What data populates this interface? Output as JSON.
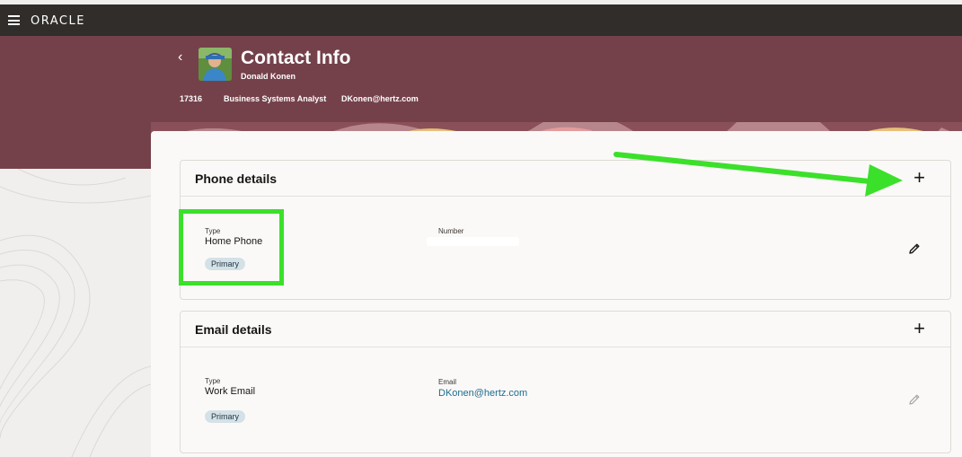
{
  "topbar": {
    "logo": "ORACLE"
  },
  "header": {
    "title": "Contact Info",
    "name": "Donald Konen",
    "person_number": "17316",
    "job_title": "Business Systems Analyst",
    "email": "DKonen@hertz.com"
  },
  "phone_section": {
    "title": "Phone details",
    "type_label": "Type",
    "type_value": "Home Phone",
    "badge": "Primary",
    "number_label": "Number",
    "number_value": ""
  },
  "email_section": {
    "title": "Email details",
    "type_label": "Type",
    "type_value": "Work Email",
    "badge": "Primary",
    "email_label": "Email",
    "email_value": "DKonen@hertz.com"
  },
  "icons": {
    "add": "plus-icon",
    "edit": "pencil-icon",
    "back": "chevron-left-icon",
    "menu": "hamburger-icon"
  },
  "colors": {
    "banner": "#74414a",
    "topbar": "#312d2a",
    "annotation": "#3be02a",
    "link": "#1c6c8f"
  }
}
